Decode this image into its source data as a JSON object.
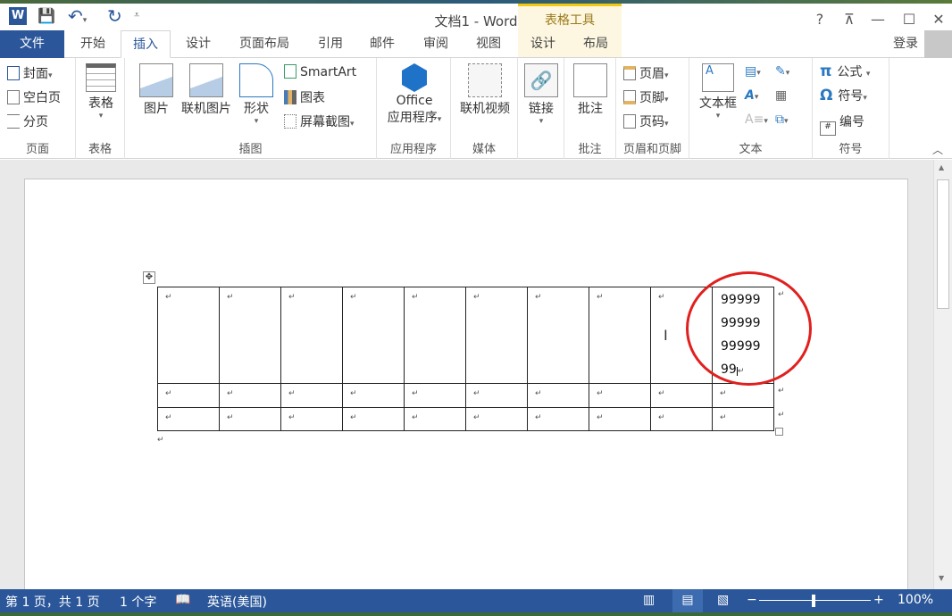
{
  "window": {
    "title": "文档1 - Word",
    "context_tab_group": "表格工具",
    "help": "?",
    "restore_ribbon": "⊼",
    "minimize": "—",
    "maximize": "☐",
    "close": "✕",
    "signin": "登录"
  },
  "tabs": [
    {
      "label": "文件"
    },
    {
      "label": "开始"
    },
    {
      "label": "插入"
    },
    {
      "label": "设计"
    },
    {
      "label": "页面布局"
    },
    {
      "label": "引用"
    },
    {
      "label": "邮件"
    },
    {
      "label": "审阅"
    },
    {
      "label": "视图"
    },
    {
      "label": "设计"
    },
    {
      "label": "布局"
    }
  ],
  "ribbon": {
    "pages": {
      "label": "页面",
      "cover": "封面",
      "blank": "空白页",
      "break": "分页"
    },
    "tables": {
      "label": "表格",
      "table": "表格"
    },
    "illustrations": {
      "label": "插图",
      "pictures": "图片",
      "online_pictures": "联机图片",
      "shapes": "形状",
      "smartart": "SmartArt",
      "chart": "图表",
      "screenshot": "屏幕截图"
    },
    "apps": {
      "label": "应用程序",
      "office1": "Office",
      "office2": "应用程序"
    },
    "media": {
      "label": "媒体",
      "online_video": "联机视频"
    },
    "links": {
      "label": "",
      "link": "链接"
    },
    "comments": {
      "label": "批注",
      "comment": "批注"
    },
    "header_footer": {
      "label": "页眉和页脚",
      "header": "页眉",
      "footer": "页脚",
      "page_number": "页码"
    },
    "text": {
      "label": "文本",
      "textbox": "文本框"
    },
    "symbols": {
      "label": "符号",
      "equation": "公式",
      "symbol": "符号",
      "number": "编号"
    }
  },
  "document": {
    "cell_mark": "↵",
    "cell_text": [
      "99999",
      "99999",
      "99999",
      "99"
    ],
    "para_mark": "↵"
  },
  "status": {
    "page": "第 1 页，共 1 页",
    "words": "1 个字",
    "language": "英语(美国)",
    "zoom": "100%",
    "zoom_minus": "−",
    "zoom_plus": "+"
  }
}
